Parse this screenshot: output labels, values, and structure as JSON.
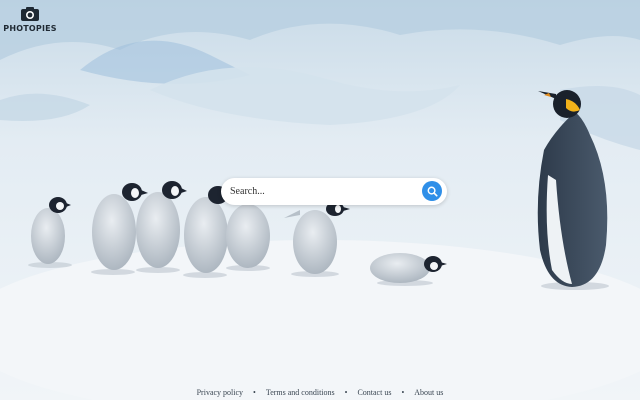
{
  "logo": {
    "text": "PHOTOPIES",
    "icon": "camera-icon"
  },
  "search": {
    "placeholder": "Search...",
    "button_icon": "search-icon"
  },
  "footer": {
    "links": [
      "Privacy policy",
      "Terms and conditions",
      "Contact us",
      "About us"
    ],
    "separator": "•"
  },
  "colors": {
    "accent": "#2f8fe8",
    "text_dark": "#1f2933"
  }
}
